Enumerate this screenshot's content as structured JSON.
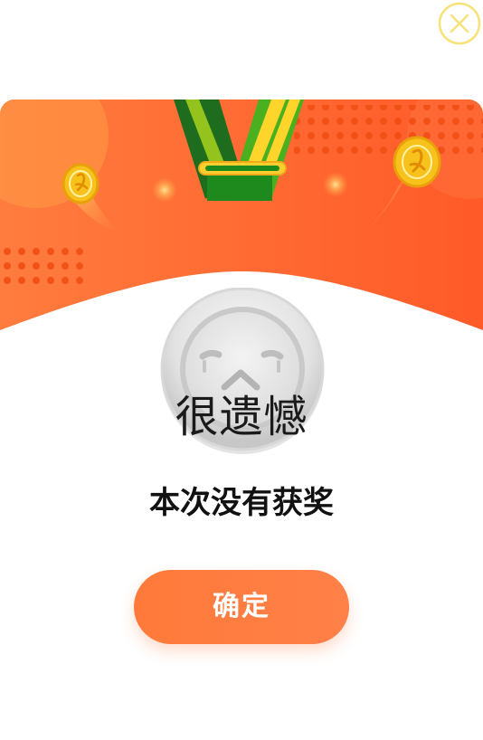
{
  "dialog": {
    "title": "很遗憾",
    "message": "本次没有获奖",
    "confirm_label": "确定"
  },
  "icons": {
    "close": "close-icon",
    "medal": "sad-silver-medal-icon",
    "ribbon": "green-medal-ribbon",
    "coins": "gold-coin-icon"
  },
  "colors": {
    "banner_orange": "#ff6a33",
    "button_orange": "#ff7a3a",
    "close_yellow": "#f7e27a",
    "medal_silver": "#d8d8d8"
  }
}
